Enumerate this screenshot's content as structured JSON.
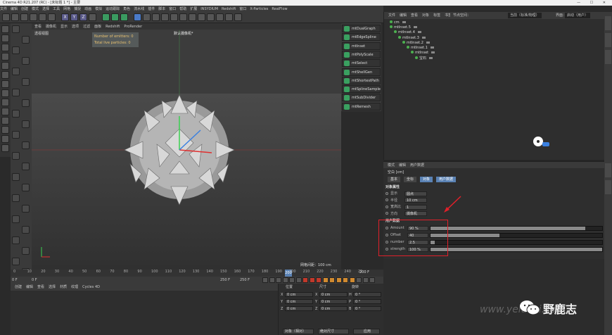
{
  "window": {
    "title": "Cinema 4D R21.207 (RC) - [未标题 1 *] - 主要",
    "controls": "— ☐ ✕"
  },
  "menubar": [
    "文件",
    "编辑",
    "创建",
    "模式",
    "选择",
    "工具",
    "网格",
    "捕捉",
    "动画",
    "模拟",
    "运动跟踪",
    "角色",
    "流水线",
    "插件",
    "脚本",
    "窗口",
    "帮助",
    "扩展",
    "INSYDIUM",
    "Redshift",
    "窗口",
    "X-Particles",
    "RealFlow"
  ],
  "toolbar_icons": [
    "undo-icon",
    "redo-icon",
    "select-icon",
    "move-icon",
    "scale-icon",
    "rotate-icon",
    "axis-x-icon",
    "axis-y-icon",
    "axis-z-icon",
    "world-icon",
    "render-region-icon",
    "render-view-icon",
    "render-settings-icon",
    "cube-icon",
    "pen-icon",
    "subdivision-icon",
    "array-icon",
    "deformer-icon",
    "floor-icon",
    "camera-icon",
    "light-icon",
    "grid-icon",
    "texture-icon",
    "paint-icon",
    "scene-icon"
  ],
  "viewport": {
    "menu": [
      "查看",
      "摄像机",
      "显示",
      "选项",
      "过滤",
      "面板",
      "Redshift",
      "ProRender"
    ],
    "view_name": "透视视图",
    "camera": "默认摄像机*",
    "hud_emitters": "Number of emitters: 0",
    "hud_particles": "Total live particles: 0",
    "grid_info": "网格间距：100 cm"
  },
  "plugins": [
    "mtDualGraph",
    "mtEdgeSpline",
    "mtInset",
    "mtPolyScale",
    "mtSelect",
    "mtShellGen",
    "mtShortestPath",
    "mtSplineSample",
    "mtSubDivider",
    "mtRemesh"
  ],
  "object_manager": {
    "menu": [
      "文件",
      "编辑",
      "查看",
      "对象",
      "标签",
      "书签"
    ],
    "tree": [
      {
        "name": "cm",
        "level": 0
      },
      {
        "name": "mtInset.5",
        "level": 0
      },
      {
        "name": "mtInset.4",
        "level": 1
      },
      {
        "name": "mtInset.3",
        "level": 2
      },
      {
        "name": "mtInset.2",
        "level": 3
      },
      {
        "name": "mtInset.1",
        "level": 4
      },
      {
        "name": "mtInset",
        "level": 5
      },
      {
        "name": "宝石",
        "level": 6
      }
    ]
  },
  "header_right": {
    "node_space": "节点空间：",
    "layout_label": "当前（标准/物理）",
    "ui_label": "界面：",
    "ui_value": "启动（用户）"
  },
  "attributes": {
    "menu": [
      "模式",
      "编辑",
      "用户数据"
    ],
    "title": "空白 [cm]",
    "tabs": [
      "基本",
      "坐标",
      "对象",
      "用户数据"
    ],
    "active_tab": 3,
    "obj_section": "对象属性",
    "obj_rows": [
      {
        "label": "显示",
        "value": "圆点"
      },
      {
        "label": "半径",
        "value": "10 cm"
      },
      {
        "label": "宽高比",
        "value": "1"
      },
      {
        "label": "方向",
        "value": "摄像机"
      }
    ],
    "user_section": "用户数据",
    "user_rows": [
      {
        "label": "Amount",
        "value": "90 %",
        "fraction": 0.9
      },
      {
        "label": "Offset",
        "value": "40",
        "fraction": 0.4
      },
      {
        "label": "number",
        "value": "2.5",
        "fraction": 0.025
      },
      {
        "label": "strength",
        "value": "100 %",
        "fraction": 1.0
      }
    ]
  },
  "timeline": {
    "ticks": [
      "0",
      "10",
      "20",
      "30",
      "40",
      "50",
      "60",
      "70",
      "80",
      "90",
      "100",
      "110",
      "120",
      "130",
      "140",
      "150",
      "160",
      "170",
      "180",
      "190",
      "200",
      "210",
      "220",
      "230",
      "240",
      "25"
    ],
    "end_label": "200 F",
    "current": "0 F",
    "start": "0 F",
    "end_a": "250 F",
    "end_b": "250 F",
    "frame_marker": "200"
  },
  "material_manager": {
    "menu": [
      "创建",
      "编辑",
      "查看",
      "选择",
      "材质",
      "纹理",
      "Cycles 4D"
    ]
  },
  "coordinates": {
    "headers": [
      "位置",
      "尺寸",
      "旋转"
    ],
    "rows": [
      {
        "axis": "X",
        "pos": "0 cm",
        "size": "0 cm",
        "rot_axis": "H",
        "rot": "0 °"
      },
      {
        "axis": "Y",
        "pos": "0 cm",
        "size": "0 cm",
        "rot_axis": "P",
        "rot": "0 °"
      },
      {
        "axis": "Z",
        "pos": "0 cm",
        "size": "0 cm",
        "rot_axis": "B",
        "rot": "0 °"
      }
    ],
    "mode": "对象（相对）",
    "size_mode": "绝对尺寸",
    "apply": "应用"
  },
  "watermark": {
    "brand": "野鹿志",
    "url": "www.yeluzhi.com"
  },
  "colors": {
    "accent": "#5a82b4",
    "highlight": "#e0202a",
    "plugin_green": "#3aa060"
  }
}
